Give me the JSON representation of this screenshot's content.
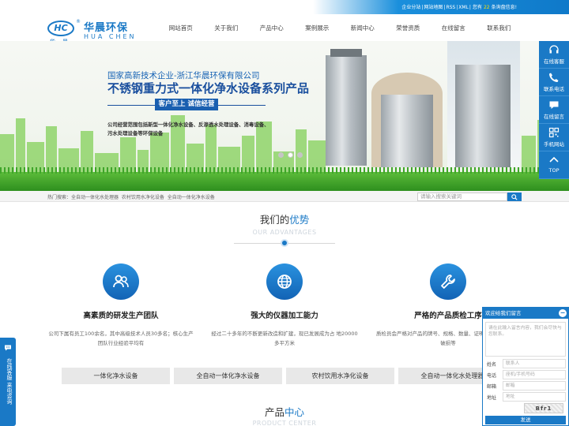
{
  "topbar": {
    "links": [
      "企业分站",
      "网站地图",
      "RSS",
      "XML"
    ],
    "inquiry_prefix": "您有",
    "inquiry_count": "22",
    "inquiry_suffix": "条询盘信息!"
  },
  "logo": {
    "mark": "HC",
    "cn_name": "华晨环保",
    "en_name": "HUA CHEN",
    "sub": "华晨"
  },
  "nav": [
    "网站首页",
    "关于我们",
    "产品中心",
    "案例展示",
    "新闻中心",
    "荣誉资质",
    "在线留言",
    "联系我们"
  ],
  "banner": {
    "line1": "国家高新技术企业-浙江华晨环保有限公司",
    "line2": "不锈钢重力式一体化净水设备系列产品",
    "slogan": "客户至上 诚信经营",
    "desc": "公司经营范围包括新型一体化净水设备、反渗透水处理设备、消毒设备、污水处理设备等环保设备"
  },
  "search": {
    "hot_label": "热门搜索：",
    "hot_items": [
      "全自动一体化水处理器",
      "农村饮用水净化设备",
      "全自动一体化净水设备"
    ],
    "placeholder": "请输入搜索关键词"
  },
  "advantages": {
    "title_a": "我们的",
    "title_b": "优势",
    "subtitle": "OUR ADVANTAGES",
    "items": [
      {
        "icon": "team-icon",
        "title": "高素质的研发生产团队",
        "desc": "公司下属有员工100余名，其中高级技术人员30多名；核心生产团队行业经验平均有"
      },
      {
        "icon": "globe-icon",
        "title": "强大的仪器加工能力",
        "desc": "经过二十多年的不断更新改造和扩建，现已发展成为占 地20000多平方米"
      },
      {
        "icon": "wrench-icon",
        "title": "严格的产品质检工序",
        "desc": "质检员会严格对产品的牌号、规格、数量、证明文件、包装有无破损等"
      }
    ]
  },
  "categories": [
    "一体化净水设备",
    "全自动一体化净水设备",
    "农村饮用水净化设备",
    "全自动一体化水处理器"
  ],
  "products": {
    "title_a": "产品",
    "title_b": "中心",
    "subtitle": "PRODUCT CENTER"
  },
  "right_tools": [
    {
      "icon": "headset-icon",
      "label": "在线客服"
    },
    {
      "icon": "phone-icon",
      "label": "联系电话"
    },
    {
      "icon": "chat-icon",
      "label": "在线留言"
    },
    {
      "icon": "qrcode-icon",
      "label": "手机网站"
    },
    {
      "icon": "arrow-up-icon",
      "label": "TOP"
    }
  ],
  "left_tab": {
    "label": "在线客服 来电咨询"
  },
  "message_box": {
    "title": "欢迎给我们留言",
    "content_placeholder": "请在此输入留言内容，我们会尽快与您联系。",
    "fields": [
      {
        "label": "姓名",
        "placeholder": "联系人"
      },
      {
        "label": "电话",
        "placeholder": "座机/手机号码"
      },
      {
        "label": "邮箱",
        "placeholder": "邮箱"
      },
      {
        "label": "地址",
        "placeholder": "地址"
      }
    ],
    "captcha": "Bfr1",
    "send_label": "发送"
  },
  "colors": {
    "brand": "#1a79c6",
    "green": "#8fd36a",
    "accent": "#ffe000"
  }
}
